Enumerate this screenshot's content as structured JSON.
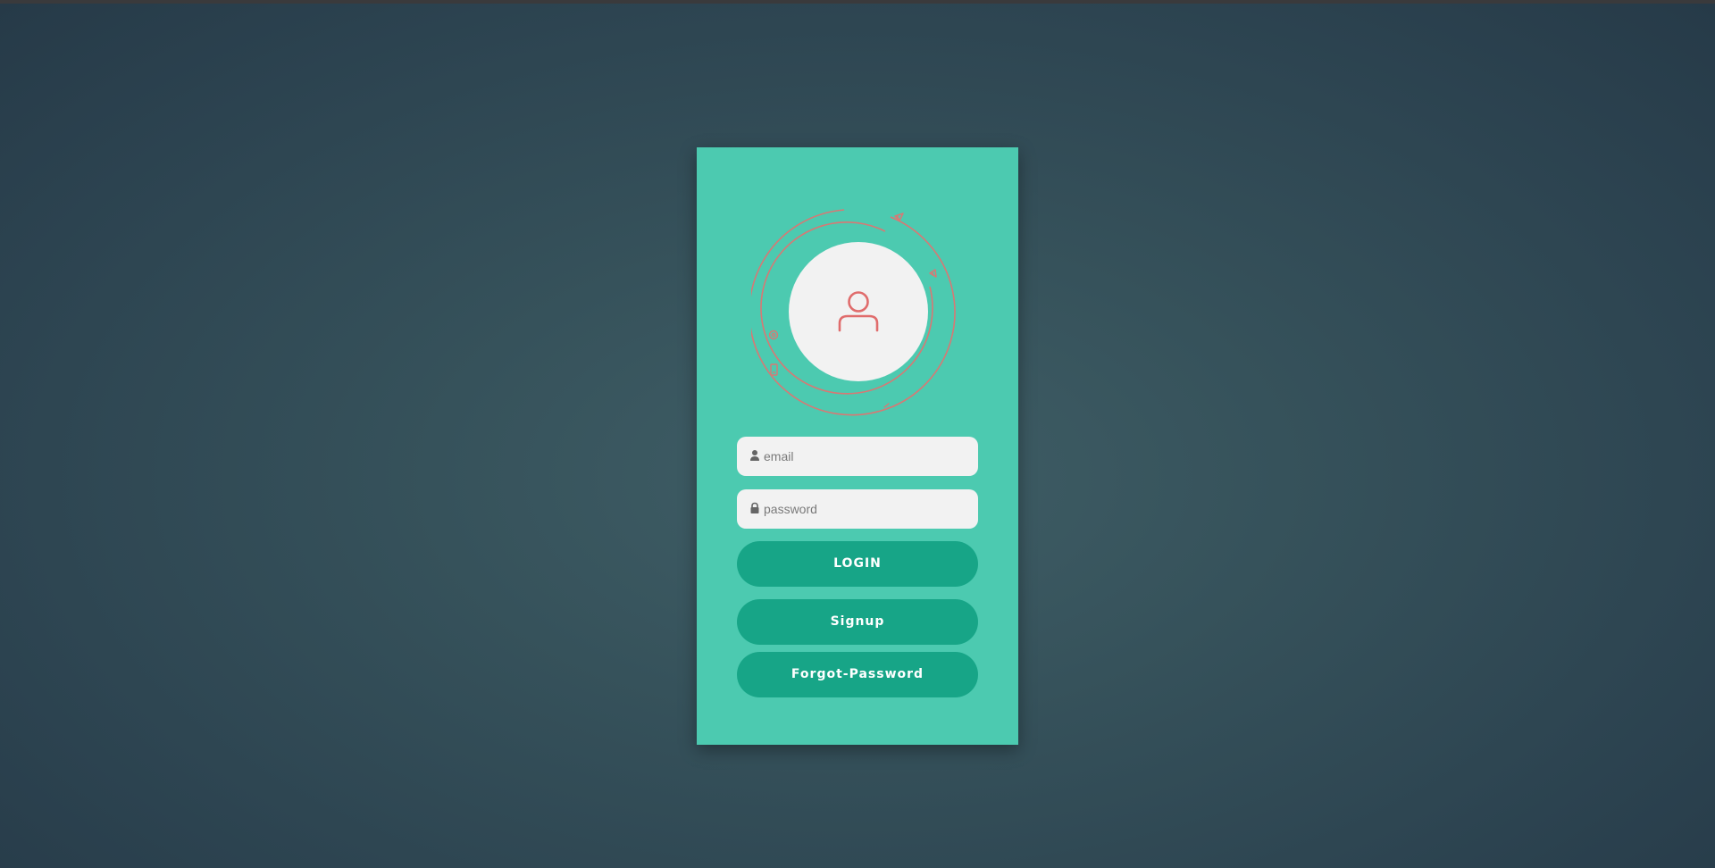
{
  "colors": {
    "background": "#36525b",
    "card": "#4ccab0",
    "button": "#17a587",
    "button_text": "#ffffff",
    "input_bg": "#f2f2f2",
    "accent_icon": "#e06c6c"
  },
  "avatar": {
    "icon": "user-icon",
    "orbit_icons": [
      "paper-plane-icon",
      "megaphone-icon",
      "at-sign-icon",
      "phone-icon",
      "link-icon"
    ]
  },
  "form": {
    "email": {
      "placeholder": "email",
      "value": "",
      "icon": "user-icon"
    },
    "password": {
      "placeholder": "password",
      "value": "",
      "icon": "lock-icon"
    }
  },
  "buttons": {
    "login": "LOGIN",
    "signup": "Signup",
    "forgot": "Forgot-Password"
  }
}
